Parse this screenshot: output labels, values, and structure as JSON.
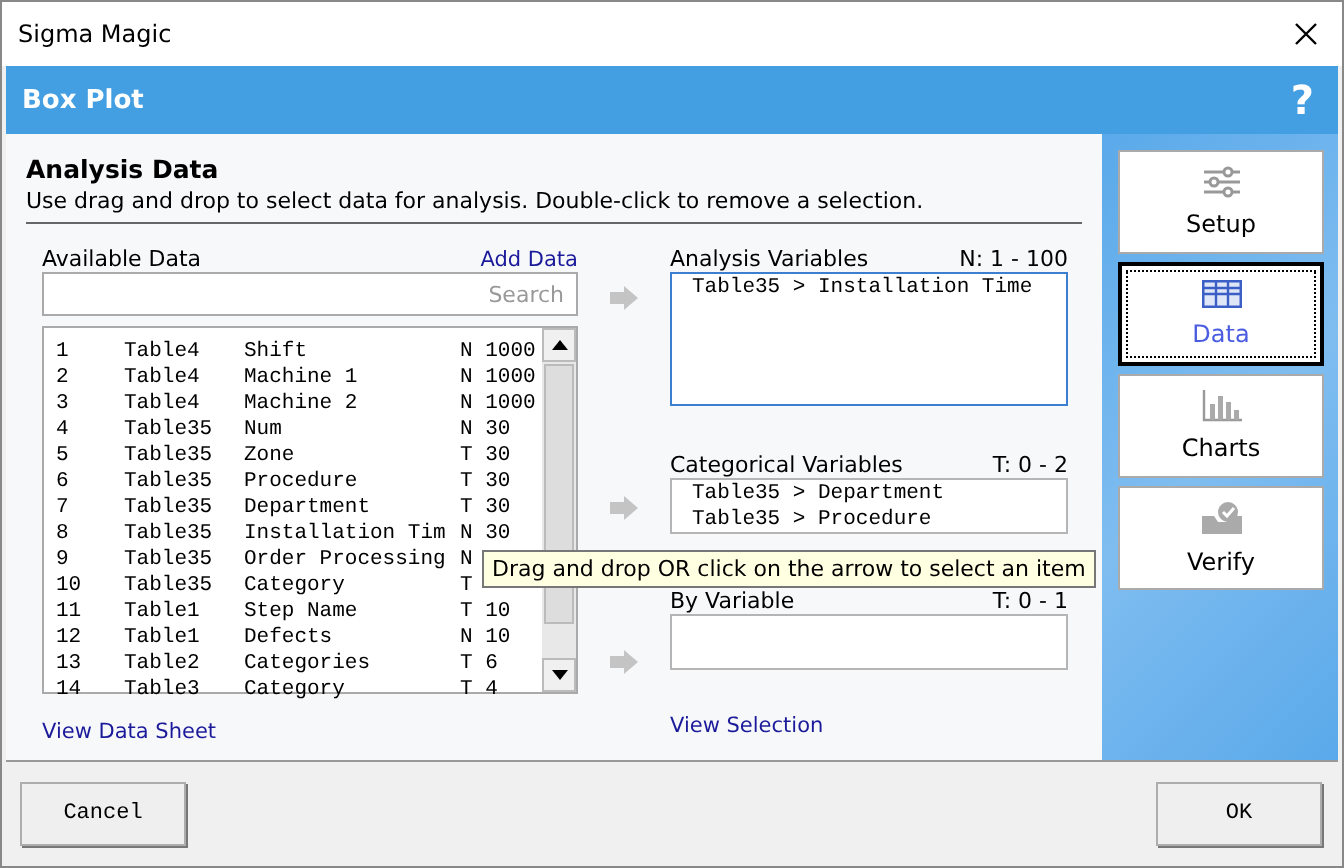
{
  "window": {
    "title": "Sigma Magic"
  },
  "header": {
    "title": "Box Plot",
    "help": "?"
  },
  "section": {
    "title": "Analysis Data",
    "subtitle": "Use drag and drop to select data for analysis. Double-click to remove a selection."
  },
  "available": {
    "label": "Available Data",
    "link": "Add Data",
    "search_placeholder": "Search",
    "footer_link": "View Data Sheet",
    "rows": [
      {
        "num": "1",
        "table": "Table4",
        "name": "Shift",
        "info": "N 1000"
      },
      {
        "num": "2",
        "table": "Table4",
        "name": "Machine 1",
        "info": "N 1000"
      },
      {
        "num": "3",
        "table": "Table4",
        "name": "Machine 2",
        "info": "N 1000"
      },
      {
        "num": "4",
        "table": "Table35",
        "name": "Num",
        "info": "N 30"
      },
      {
        "num": "5",
        "table": "Table35",
        "name": "Zone",
        "info": "T 30"
      },
      {
        "num": "6",
        "table": "Table35",
        "name": "Procedure",
        "info": "T 30"
      },
      {
        "num": "7",
        "table": "Table35",
        "name": "Department",
        "info": "T 30"
      },
      {
        "num": "8",
        "table": "Table35",
        "name": "Installation Tim",
        "info": "N 30"
      },
      {
        "num": "9",
        "table": "Table35",
        "name": "Order Processing",
        "info": "N"
      },
      {
        "num": "10",
        "table": "Table35",
        "name": "Category",
        "info": "T"
      },
      {
        "num": "11",
        "table": "Table1",
        "name": "Step Name",
        "info": "T 10"
      },
      {
        "num": "12",
        "table": "Table1",
        "name": "Defects",
        "info": "N 10"
      },
      {
        "num": "13",
        "table": "Table2",
        "name": "Categories",
        "info": "T 6"
      },
      {
        "num": "14",
        "table": "Table3",
        "name": "Category",
        "info": "T 4"
      }
    ]
  },
  "targets": [
    {
      "label": "Analysis Variables",
      "range": "N: 1 - 100",
      "focused": true,
      "items": [
        "Table35 > Installation Time"
      ]
    },
    {
      "label": "Categorical Variables",
      "range": "T: 0 - 2",
      "focused": false,
      "items": [
        "Table35 > Department",
        "Table35 > Procedure"
      ]
    },
    {
      "label": "By Variable",
      "range": "T: 0 - 1",
      "focused": false
    }
  ],
  "view_selection": "View Selection",
  "tooltip": "Drag and drop OR click on the arrow to select an item",
  "nav": [
    {
      "label": "Setup",
      "selected": false
    },
    {
      "label": "Data",
      "selected": true
    },
    {
      "label": "Charts",
      "selected": false
    },
    {
      "label": "Verify",
      "selected": false
    }
  ],
  "buttons": [
    {
      "label": "Cancel"
    },
    {
      "label": "OK"
    }
  ]
}
